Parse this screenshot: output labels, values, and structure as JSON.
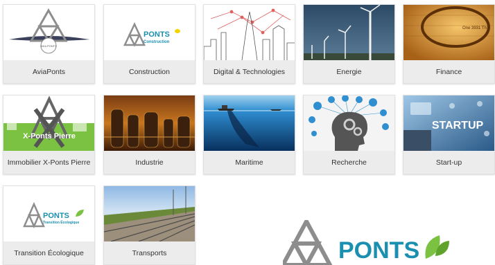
{
  "categories": [
    {
      "label": "AviaPonts",
      "icon": "aviaponts-logo",
      "thumb_text": "AVIA PONTS"
    },
    {
      "label": "Construction",
      "icon": "ponts-construction-logo",
      "thumb_text": "PONTS",
      "thumb_sub": "Construction"
    },
    {
      "label": "Digital & Technologies",
      "icon": "city-skyline-network-image"
    },
    {
      "label": "Energie",
      "icon": "wind-turbines-image"
    },
    {
      "label": "Finance",
      "icon": "banknote-magnifier-image"
    },
    {
      "label": "Immobilier X-Ponts Pierre",
      "icon": "x-ponts-pierre-logo",
      "thumb_text": "X-Ponts Pierre"
    },
    {
      "label": "Industrie",
      "icon": "refinery-image"
    },
    {
      "label": "Maritime",
      "icon": "sea-ship-image"
    },
    {
      "label": "Recherche",
      "icon": "brain-gears-image"
    },
    {
      "label": "Start-up",
      "icon": "startup-screen-image",
      "thumb_text": "STARTUP"
    },
    {
      "label": "Transition Écologique",
      "icon": "ponts-transition-logo",
      "thumb_text": "PONTS",
      "thumb_sub": "Transition Écologique"
    },
    {
      "label": "Transports",
      "icon": "railway-tracks-image"
    }
  ],
  "watermark": {
    "text": "PONTS",
    "icon": "ponts-leaf-logo"
  },
  "colors": {
    "brand_blue": "#1b8fb0",
    "brand_gray": "#8d8d8d",
    "leaf_green": "#7cc242",
    "label_bg": "#ececec"
  }
}
